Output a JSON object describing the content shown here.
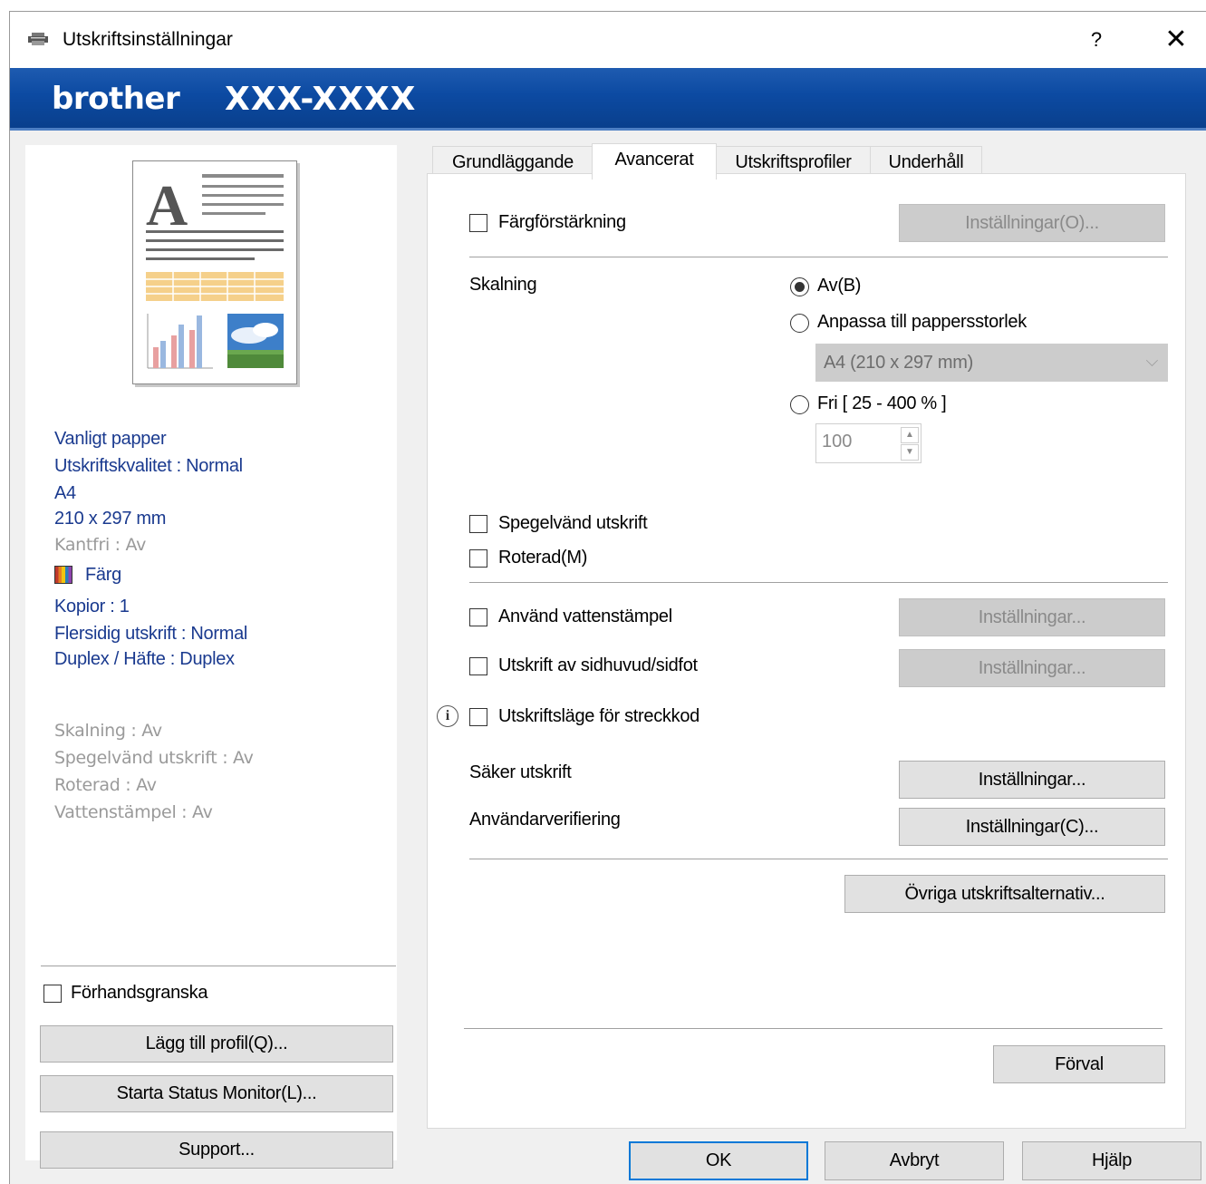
{
  "window": {
    "title": "Utskriftsinställningar",
    "help_label": "?",
    "close_label": "✕"
  },
  "banner": {
    "brand": "brother",
    "model": "XXX-XXXX"
  },
  "summary": {
    "lines_blue": [
      "Vanligt papper",
      "Utskriftskvalitet : Normal",
      "A4",
      "210 x 297 mm"
    ],
    "borderless": "Kantfri : Av",
    "color": "Färg",
    "lines_blue2": [
      "Kopior : 1",
      "Flersidig utskrift : Normal",
      "Duplex / Häfte : Duplex"
    ],
    "lines_gray": [
      "Skalning : Av",
      "Spegelvänd utskrift : Av",
      "Roterad : Av",
      "Vattenstämpel : Av"
    ]
  },
  "left_controls": {
    "preview_label": "Förhandsgranska",
    "add_profile": "Lägg till profil(Q)...",
    "status_monitor": "Starta Status Monitor(L)...",
    "support": "Support..."
  },
  "tabs": [
    "Grundläggande",
    "Avancerat",
    "Utskriftsprofiler",
    "Underhåll"
  ],
  "advanced": {
    "color_enhance_label": "Färgförstärkning",
    "color_enhance_settings": "Inställningar(O)...",
    "scaling_label": "Skalning",
    "scaling_off": "Av(B)",
    "scaling_fit": "Anpassa till pappersstorlek",
    "paper_size": "A4 (210 x 297 mm)",
    "scaling_free": "Fri [ 25 - 400 % ]",
    "scaling_value": "100",
    "mirror_label": "Spegelvänd utskrift",
    "rotate_label": "Roterad(M)",
    "watermark_label": "Använd vattenstämpel",
    "watermark_settings": "Inställningar...",
    "header_footer_label": "Utskrift av sidhuvud/sidfot",
    "header_footer_settings": "Inställningar...",
    "barcode_label": "Utskriftsläge för streckkod",
    "secure_print_label": "Säker utskrift",
    "secure_print_settings": "Inställningar...",
    "user_verify_label": "Användarverifiering",
    "user_verify_settings": "Inställningar(C)...",
    "other_options": "Övriga utskriftsalternativ...",
    "defaults": "Förval"
  },
  "footer": {
    "ok": "OK",
    "cancel": "Avbryt",
    "help": "Hjälp"
  }
}
